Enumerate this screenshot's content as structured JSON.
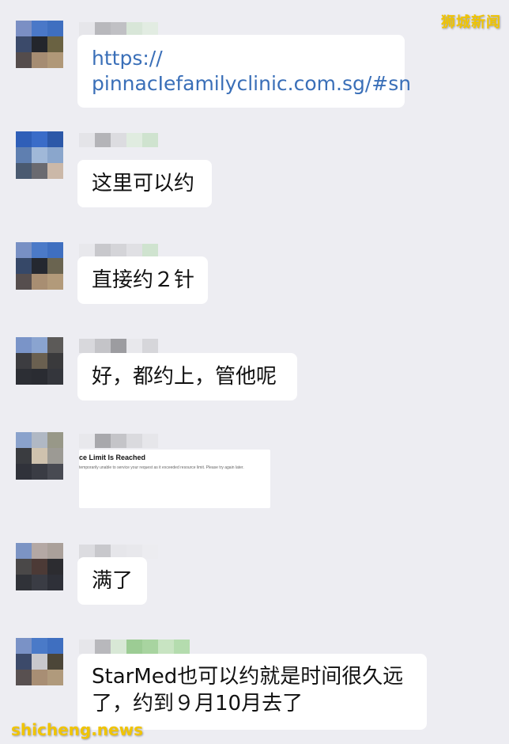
{
  "watermark_top_right": "狮城新闻",
  "watermark_bottom_left": "shicheng.news",
  "colors": {
    "background": "#ededf2",
    "bubble": "#ffffff",
    "link": "#3a6fb8",
    "watermark": "#f0c400"
  },
  "messages": [
    {
      "type": "link",
      "lines": [
        "https://",
        "pinnacIefamilyclinic.com.sg/#sn"
      ]
    },
    {
      "type": "text",
      "lines": [
        "这里可以约"
      ]
    },
    {
      "type": "text",
      "lines": [
        "直接约２针"
      ]
    },
    {
      "type": "text",
      "lines": [
        "好，都约上，管他呢"
      ]
    },
    {
      "type": "image",
      "heading": "ce Limit Is Reached",
      "body": "temporarily unable to service your request as it exceeded resource limit. Please try again later."
    },
    {
      "type": "text",
      "lines": [
        "满了"
      ]
    },
    {
      "type": "text",
      "lines": [
        "StarMed也可以约就是时间很久远",
        "了，约到９月10月去了"
      ]
    }
  ]
}
